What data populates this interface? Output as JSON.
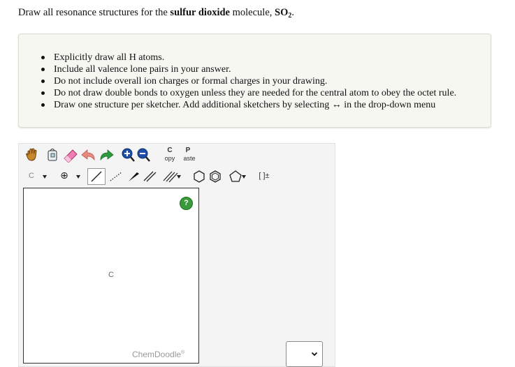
{
  "question": {
    "prefix": "Draw all resonance structures for the ",
    "compound": "sulfur dioxide",
    "middle": " molecule, ",
    "formula_main": "SO",
    "formula_sub": "2",
    "suffix": "."
  },
  "instructions": [
    "Explicitly draw all H atoms.",
    "Include all valence lone pairs in your answer.",
    "Do not include overall ion charges or formal charges in your drawing.",
    "Do not draw double bonds to oxygen unless they are needed for the central atom to obey the octet rule.",
    "Draw one structure per sketcher. Add additional sketchers by selecting ↔ in the drop-down menu"
  ],
  "sketcher": {
    "copy_top": "C",
    "copy_bottom": "opy",
    "paste_top": "P",
    "paste_bottom": "aste",
    "atom_button_label": "C",
    "charge_symbol": "⊕",
    "bracket_label": "[ ]±",
    "canvas_atom": "C",
    "help_label": "?",
    "brand": "ChemDoodle",
    "brand_mark": "®"
  },
  "selector": {
    "value": ""
  }
}
